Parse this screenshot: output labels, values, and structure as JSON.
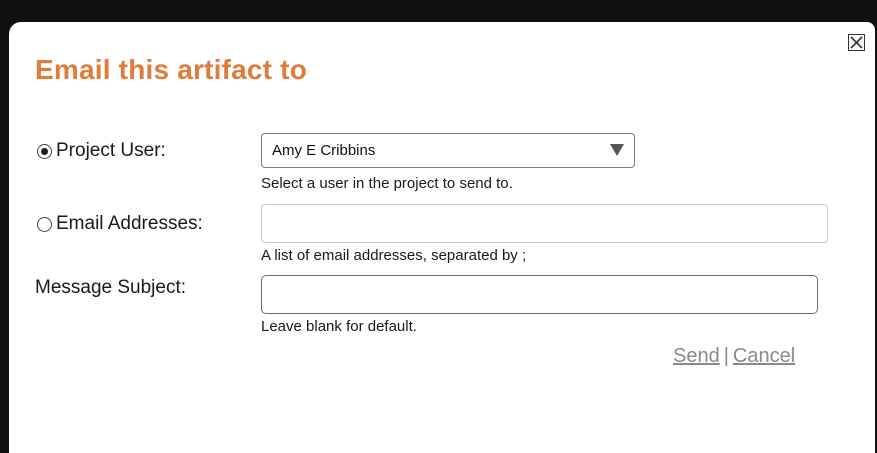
{
  "dialog": {
    "title": "Email this artifact to",
    "project_user": {
      "label": "Project User:",
      "selected": true,
      "value": "Amy E Cribbins",
      "hint": "Select a user in the project to send to."
    },
    "email_addresses": {
      "label": "Email Addresses:",
      "selected": false,
      "value": "",
      "hint": "A list of email addresses, separated by ;"
    },
    "message_subject": {
      "label": "Message Subject:",
      "value": "",
      "hint": "Leave blank for default."
    },
    "actions": {
      "send": "Send",
      "separator": "|",
      "cancel": "Cancel"
    },
    "icons": {
      "close": "close-icon",
      "dropdown": "caret-down-icon"
    },
    "colors": {
      "title": "#e07b39",
      "link": "#8a8a8a"
    }
  }
}
